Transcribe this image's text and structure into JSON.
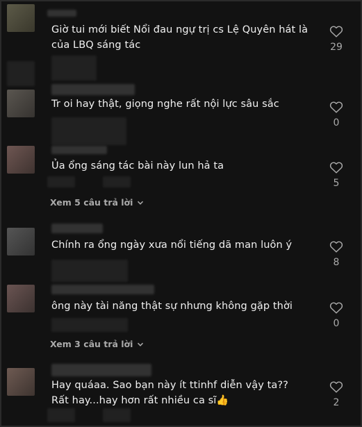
{
  "comments": [
    {
      "text": "Giờ tui mới biết Nổi đau ngự trị cs Lệ Quyên hát là của LBQ sáng tác",
      "likes": "29",
      "replies": null
    },
    {
      "text": "Tr oi hay thật, giọng nghe rất nội lực sâu sắc",
      "likes": "0",
      "replies": null
    },
    {
      "text": "Ủa ổng sáng tác bài này lun hả ta",
      "likes": "5",
      "replies": "Xem 5 câu trả lời"
    },
    {
      "text": "Chính ra ổng ngày xưa nổi tiếng dã man luôn ý",
      "likes": "8",
      "replies": null
    },
    {
      "text": "ông này tài năng thật sự nhưng không gặp thời",
      "likes": "0",
      "replies": "Xem 3 câu trả lời"
    },
    {
      "text": "Hay quáaa. Sao bạn này ít ttinhf diễn vậy ta?? Rất hay...hay hơn rất nhiều ca sĩ👍",
      "likes": "2",
      "replies": null
    }
  ],
  "icons": {
    "like": "heart-icon",
    "expand": "chevron-down-icon"
  },
  "colors": {
    "background": "#121212",
    "text": "#f1f1f1",
    "muted": "#aaaaaa"
  }
}
